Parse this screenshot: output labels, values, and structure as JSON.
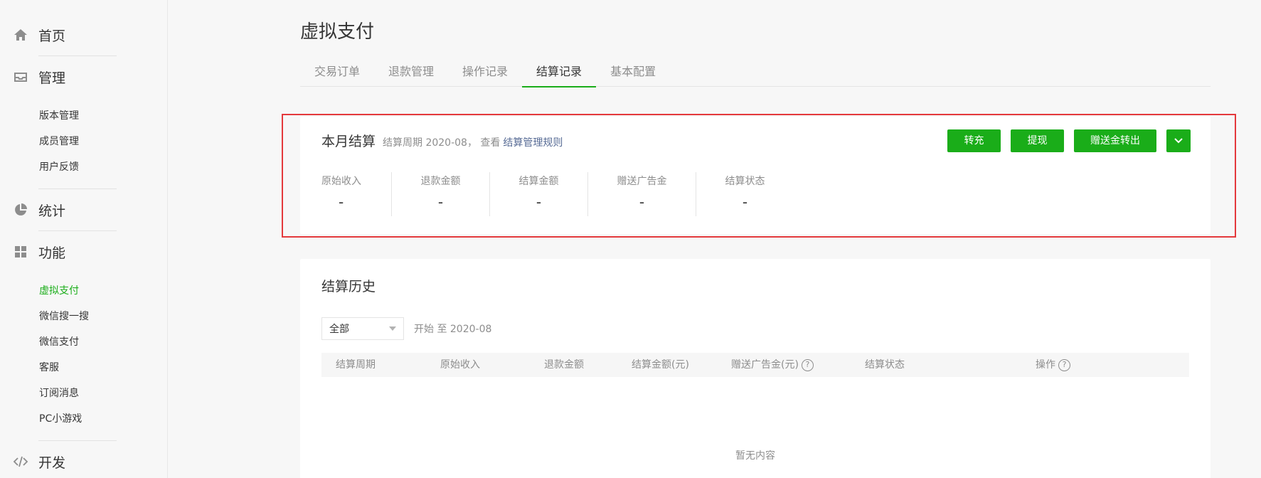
{
  "sidebar": {
    "home": {
      "label": "首页",
      "icon": "home-icon"
    },
    "manage": {
      "label": "管理",
      "icon": "inbox-icon",
      "items": [
        "版本管理",
        "成员管理",
        "用户反馈"
      ]
    },
    "stats": {
      "label": "统计",
      "icon": "pie-chart-icon"
    },
    "features": {
      "label": "功能",
      "icon": "grid-icon",
      "items": [
        "虚拟支付",
        "微信搜一搜",
        "微信支付",
        "客服",
        "订阅消息",
        "PC小游戏"
      ],
      "active_index": 0
    },
    "dev": {
      "label": "开发",
      "icon": "code-icon"
    }
  },
  "page": {
    "title": "虚拟支付"
  },
  "tabs": [
    "交易订单",
    "退款管理",
    "操作记录",
    "结算记录",
    "基本配置"
  ],
  "active_tab": 3,
  "monthly": {
    "title": "本月结算",
    "period_text": "结算周期 2020-08， 查看",
    "rules_link": "结算管理规则",
    "buttons": {
      "recharge": "转充",
      "withdraw": "提现",
      "gift_transfer": "赠送金转出"
    },
    "stats": [
      {
        "label": "原始收入",
        "value": "-"
      },
      {
        "label": "退款金额",
        "value": "-"
      },
      {
        "label": "结算金额",
        "value": "-"
      },
      {
        "label": "赠送广告金",
        "value": "-"
      },
      {
        "label": "结算状态",
        "value": "-"
      }
    ]
  },
  "history": {
    "title": "结算历史",
    "filter_value": "全部",
    "range_text": "开始 至 2020-08",
    "columns": [
      "结算周期",
      "原始收入",
      "退款金额",
      "结算金额(元)",
      "赠送广告金(元)",
      "结算状态",
      "操作"
    ],
    "empty_text": "暂无内容"
  },
  "colors": {
    "accent": "#1aad19",
    "highlight_border": "#e4393c",
    "link": "#576b95"
  }
}
